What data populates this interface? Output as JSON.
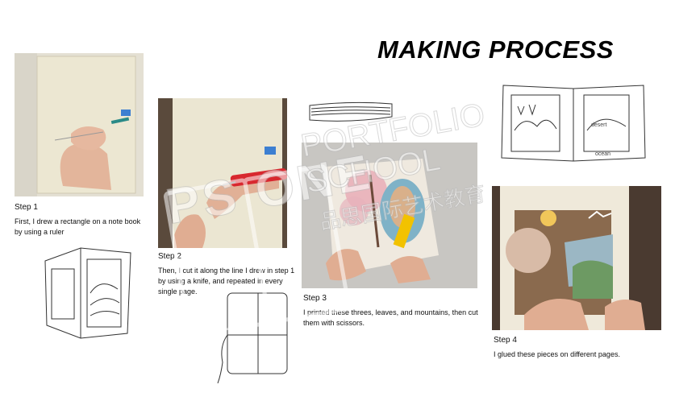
{
  "title": "MAKING PROCESS",
  "steps": [
    {
      "label": "Step 1",
      "text": "First, I drew a rectangle on a note book by using a ruler"
    },
    {
      "label": "Step 2",
      "text": "Then, I cut it along the line I drew in step 1 by using a knife, and repeated in every single page."
    },
    {
      "label": "Step 3",
      "text": "I printed these threes, leaves, and mountains, then cut them with scissors."
    },
    {
      "label": "Step 4",
      "text": "I glued these pieces on different pages."
    }
  ],
  "sketch_notes": [
    "ocean",
    "desert"
  ],
  "watermark": {
    "logo_letters": "PS ONE",
    "line1": "PORTFOLIO",
    "line2": "SCHOOL",
    "line3": "品思国际艺术教育"
  },
  "colors": {
    "paper": "#e9e4cf",
    "dark_bg": "#3a2a22",
    "knife_red": "#d8282f",
    "scissors_yellow": "#f2c200",
    "blossom_pink": "#e9a9b4"
  }
}
